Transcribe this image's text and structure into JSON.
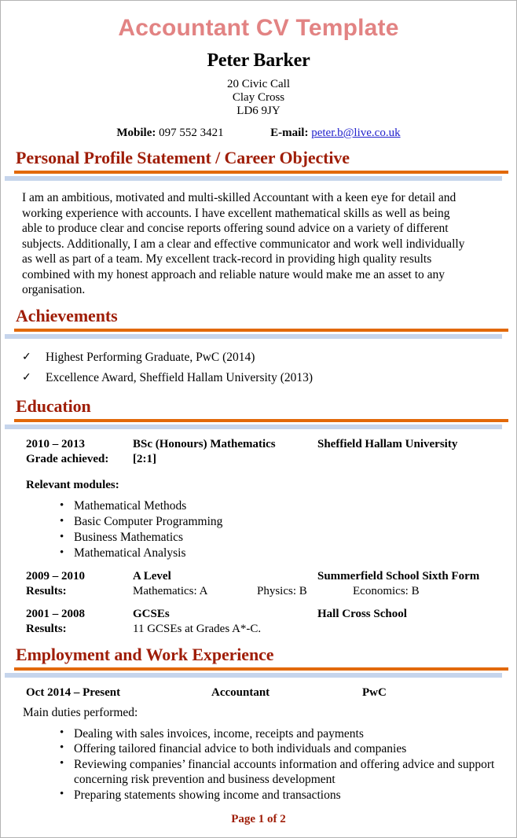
{
  "document": {
    "title": "Accountant CV Template",
    "footer": "Page 1 of 2"
  },
  "header": {
    "name": "Peter Barker",
    "address": [
      "20 Civic Call",
      "Clay Cross",
      "LD6 9JY"
    ],
    "mobile_label": "Mobile:",
    "mobile_value": "097 552 3421",
    "email_label": "E-mail:",
    "email_value": "peter.b@live.co.uk"
  },
  "sections": {
    "profile": {
      "heading": "Personal Profile Statement / Career Objective",
      "text": "I am an ambitious, motivated and multi-skilled Accountant with a keen eye for detail and working experience with accounts. I have excellent mathematical skills as well as being able to produce clear and concise reports offering sound advice on a variety of different subjects. Additionally, I am a clear and effective communicator and work well individually as well as part of a team. My excellent track-record in providing high quality results combined with my honest approach and reliable nature would make me an asset to any organisation."
    },
    "achievements": {
      "heading": "Achievements",
      "tick": "✓",
      "items": [
        "Highest Performing Graduate, PwC (2014)",
        "Excellence Award, Sheffield Hallam University (2013)"
      ]
    },
    "education": {
      "heading": "Education",
      "degree": {
        "date": "2010 – 2013",
        "title": "BSc (Honours) Mathematics",
        "org": "Sheffield Hallam University",
        "grade_label": "Grade achieved:",
        "grade_value": "[2:1]"
      },
      "modules_label": "Relevant modules:",
      "modules": [
        "Mathematical Methods",
        "Basic Computer Programming",
        "Business Mathematics",
        "Mathematical Analysis"
      ],
      "alevel": {
        "date": "2009 – 2010",
        "title": "A Level",
        "org": "Summerfield School Sixth Form",
        "results_label": "Results:",
        "result_1": "Mathematics: A",
        "result_2": "Physics: B",
        "result_3": "Economics: B"
      },
      "gcse": {
        "date": "2001 – 2008",
        "title": "GCSEs",
        "org": "Hall Cross School",
        "results_label": "Results:",
        "results_value": "11 GCSEs at Grades A*-C."
      }
    },
    "employment": {
      "heading": "Employment and Work Experience",
      "job": {
        "date": "Oct 2014 – Present",
        "title": "Accountant",
        "org": "PwC",
        "duties_label": "Main duties performed:",
        "duties": [
          "Dealing with sales invoices, income, receipts and payments",
          "Offering tailored financial advice to both individuals and companies",
          "Reviewing companies’ financial accounts information and offering advice and support concerning risk prevention and business development",
          "Preparing statements showing income and transactions"
        ]
      }
    }
  },
  "colors": {
    "title": "#e28383",
    "heading": "#9f1d07",
    "rule_orange": "#e2690a",
    "rule_blue": "#c6d5ec",
    "link": "#2222cc"
  }
}
